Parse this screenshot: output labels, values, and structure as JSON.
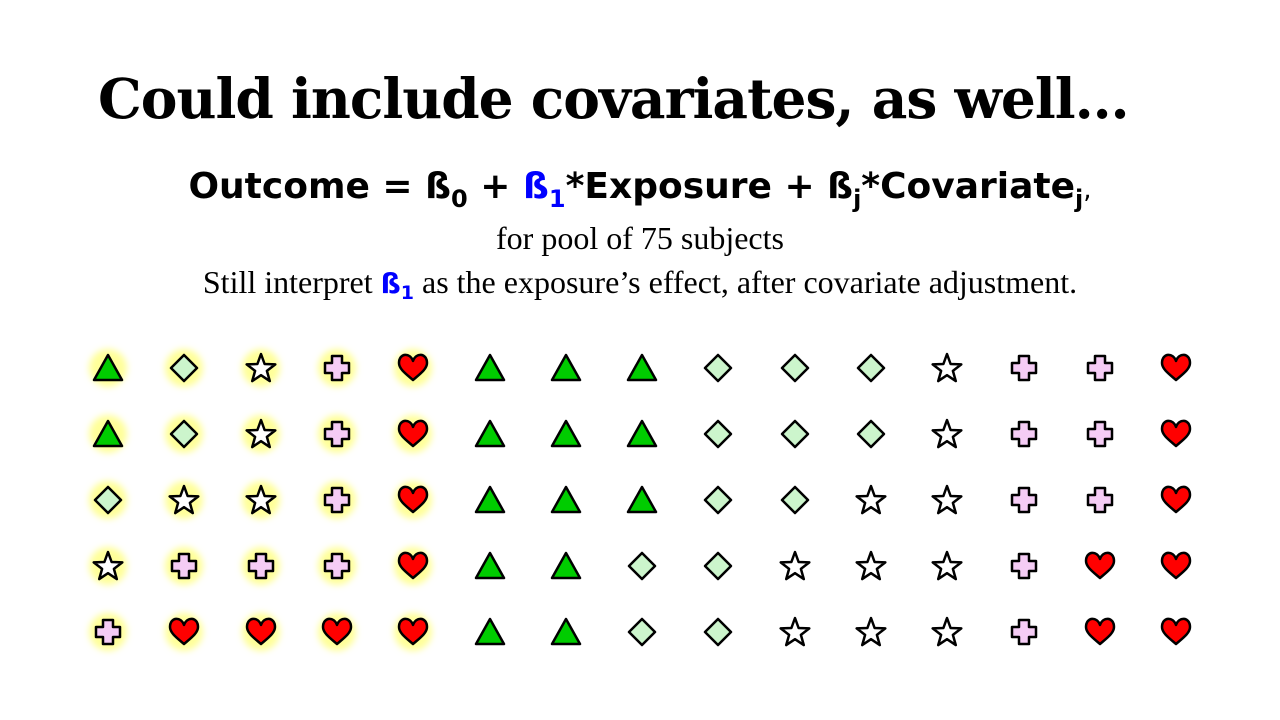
{
  "slide": {
    "title": "Could include covariates, as well…",
    "equation": {
      "part1": "Outcome = ß",
      "sub0": "0",
      "part2": " + ",
      "beta1": "ß",
      "sub1": "1",
      "part3": "*Exposure + ß",
      "subj": "j",
      "part4": "*Covariate",
      "subj2": "j",
      "tail": ","
    },
    "pool_line": "for pool of 75 subjects",
    "interpret": {
      "before": "Still interpret ",
      "beta": "ß",
      "sub": "1",
      "after": " as the exposure’s effect, after covariate adjustment."
    }
  },
  "legend_shapes": {
    "triangle": "triangle-icon",
    "diamond": "diamond-icon",
    "star": "star-icon",
    "cross": "cross-icon",
    "heart": "heart-icon"
  },
  "colors": {
    "triangle": "#00cc00",
    "diamond": "#ccf5cc",
    "star": "#ffffff",
    "cross": "#f5ccf5",
    "heart": "#ff0000",
    "highlight": "#ffff99",
    "beta_blue": "#0000ff"
  },
  "grid": {
    "rows": [
      {
        "shapes": [
          "triangle",
          "diamond",
          "star",
          "cross",
          "heart",
          "triangle",
          "triangle",
          "triangle",
          "diamond",
          "diamond",
          "diamond",
          "star",
          "cross",
          "cross",
          "heart"
        ],
        "highlighted": [
          true,
          true,
          true,
          true,
          true,
          false,
          false,
          false,
          false,
          false,
          false,
          false,
          false,
          false,
          false
        ]
      },
      {
        "shapes": [
          "triangle",
          "diamond",
          "star",
          "cross",
          "heart",
          "triangle",
          "triangle",
          "triangle",
          "diamond",
          "diamond",
          "diamond",
          "star",
          "cross",
          "cross",
          "heart"
        ],
        "highlighted": [
          true,
          true,
          true,
          true,
          true,
          false,
          false,
          false,
          false,
          false,
          false,
          false,
          false,
          false,
          false
        ]
      },
      {
        "shapes": [
          "diamond",
          "star",
          "star",
          "cross",
          "heart",
          "triangle",
          "triangle",
          "triangle",
          "diamond",
          "diamond",
          "star",
          "star",
          "cross",
          "cross",
          "heart"
        ],
        "highlighted": [
          true,
          true,
          true,
          true,
          true,
          false,
          false,
          false,
          false,
          false,
          false,
          false,
          false,
          false,
          false
        ]
      },
      {
        "shapes": [
          "star",
          "cross",
          "cross",
          "cross",
          "heart",
          "triangle",
          "triangle",
          "diamond",
          "diamond",
          "star",
          "star",
          "star",
          "cross",
          "heart",
          "heart"
        ],
        "highlighted": [
          true,
          true,
          true,
          true,
          true,
          false,
          false,
          false,
          false,
          false,
          false,
          false,
          false,
          false,
          false
        ]
      },
      {
        "shapes": [
          "cross",
          "heart",
          "heart",
          "heart",
          "heart",
          "triangle",
          "triangle",
          "diamond",
          "diamond",
          "star",
          "star",
          "star",
          "cross",
          "heart",
          "heart"
        ],
        "highlighted": [
          true,
          true,
          true,
          true,
          true,
          false,
          false,
          false,
          false,
          false,
          false,
          false,
          false,
          false,
          false
        ]
      }
    ]
  }
}
